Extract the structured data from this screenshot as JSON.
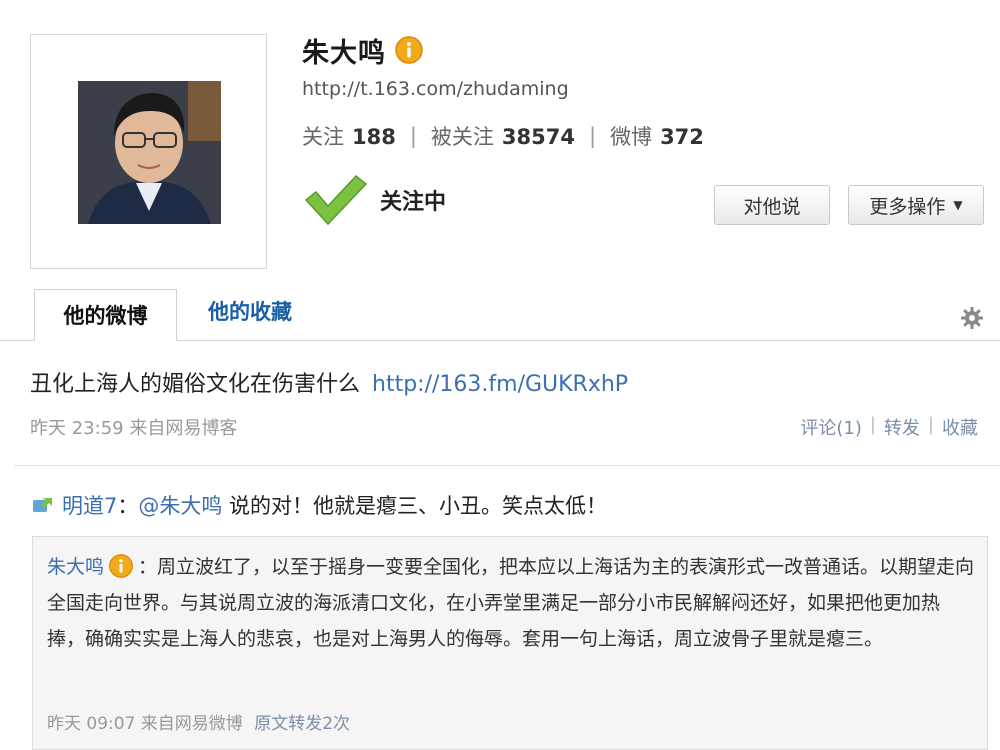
{
  "profile": {
    "name": "朱大鸣",
    "url": "http://t.163.com/zhudaming",
    "stats": [
      {
        "label": "关注",
        "value": "188"
      },
      {
        "label": "被关注",
        "value": "38574"
      },
      {
        "label": "微博",
        "value": "372"
      }
    ],
    "follow_status": "关注中",
    "buttons": {
      "dm": "对他说",
      "more": "更多操作"
    }
  },
  "tabs": [
    {
      "label": "他的微博",
      "active": true
    },
    {
      "label": "他的收藏",
      "active": false
    }
  ],
  "post": {
    "text": "丑化上海人的媚俗文化在伤害什么",
    "link": "http://163.fm/GUKRxhP",
    "meta": "昨天 23:59 来自网易博客",
    "actions": {
      "comment": "评论(1)",
      "forward": "转发",
      "favorite": "收藏"
    }
  },
  "repost": {
    "author": "明道7",
    "colon": "：",
    "mention": "@朱大鸣",
    "text": " 说的对！他就是瘪三、小丑。笑点太低！"
  },
  "quote": {
    "author": "朱大鸣",
    "text": "：周立波红了，以至于摇身一变要全国化，把本应以上海话为主的表演形式一改普通话。以期望走向全国走向世界。与其说周立波的海派清口文化，在小弄堂里满足一部分小市民解解闷还好，如果把他更加热捧，确确实实是上海人的悲哀，也是对上海男人的侮辱。套用一句上海话，周立波骨子里就是瘪三。",
    "meta": "昨天 09:07 来自网易微博",
    "original_forward": "原文转发2次"
  },
  "colors": {
    "link": "#3c6fb0",
    "check": "#7bc142",
    "badge": "#f2a91a"
  },
  "icons": [
    "verified-icon",
    "checkmark-icon",
    "caret-down-icon",
    "gear-icon",
    "repost-icon"
  ]
}
